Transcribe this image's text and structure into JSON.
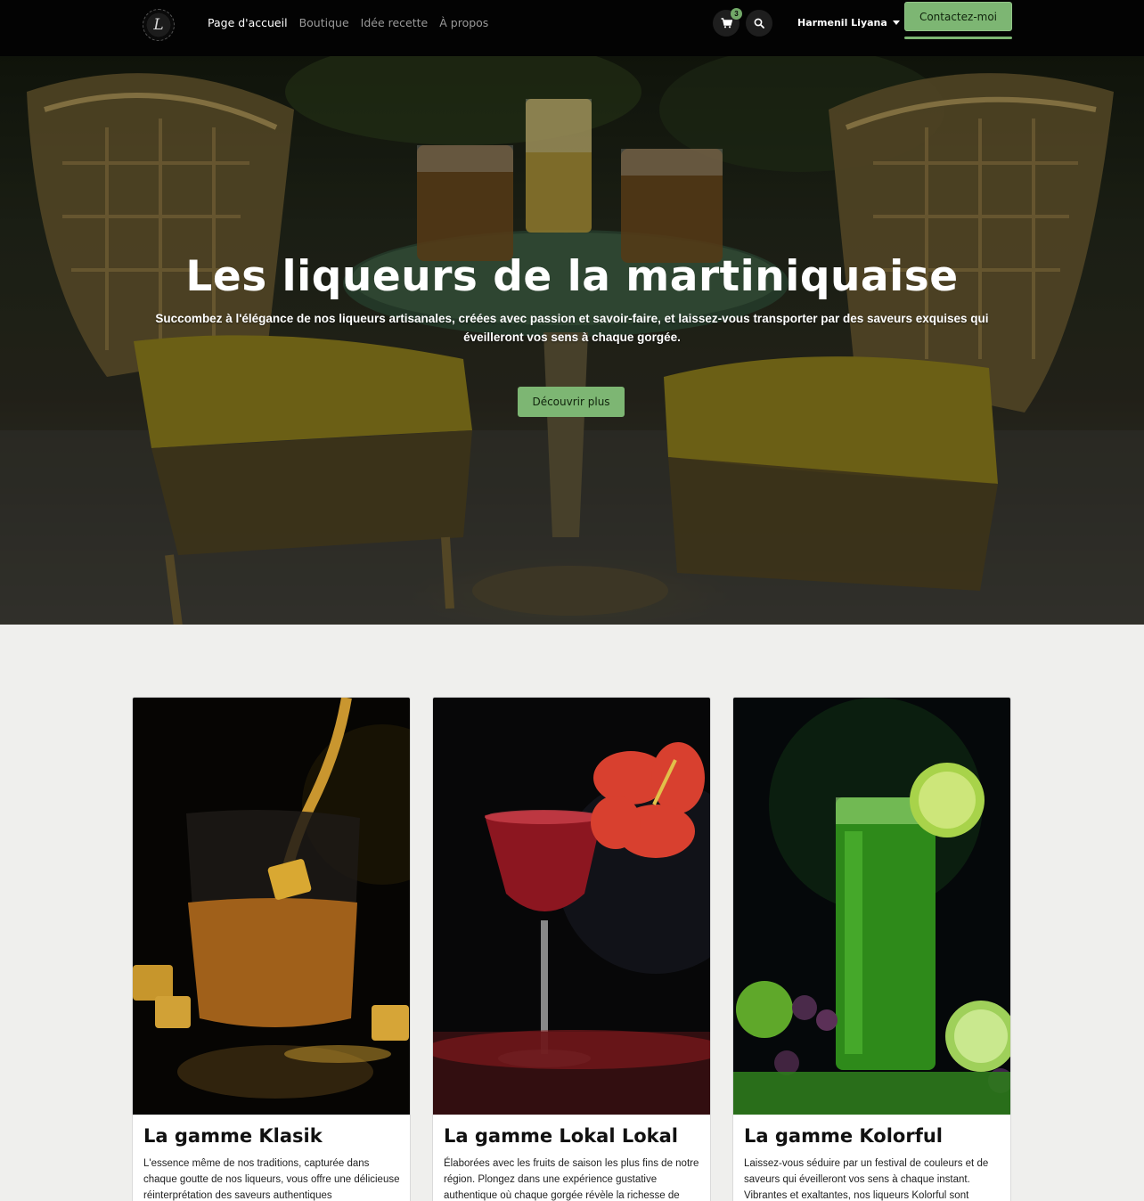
{
  "nav": {
    "links": [
      "Page d'accueil",
      "Boutique",
      "Idée recette",
      "À propos"
    ],
    "cart_count": "3",
    "user_name": "Harmenil Liyana",
    "contact_label": "Contactez-moi",
    "logo_glyph": "L"
  },
  "hero": {
    "title": "Les liqueurs de la martiniquaise",
    "subtitle": "Succombez à l'élégance de nos liqueurs artisanales, créées avec passion et savoir-faire, et laissez-vous transporter par des saveurs exquises qui éveilleront vos sens à chaque gorgée.",
    "cta_label": "Découvrir plus"
  },
  "cards": [
    {
      "title": "La gamme Klasik",
      "text": "L'essence même de nos traditions, capturée dans chaque goutte de nos liqueurs, vous offre une délicieuse réinterprétation des saveurs authentiques"
    },
    {
      "title": "La gamme Lokal Lokal",
      "text": "Élaborées avec les fruits  de saison les plus fins de notre région. Plongez dans une expérience gustative authentique où chaque gorgée révèle la richesse de"
    },
    {
      "title": "La gamme Kolorful",
      "text": "Laissez-vous séduire par un festival de couleurs et de saveurs qui éveilleront vos sens à chaque instant. Vibrantes et exaltantes, nos liqueurs Kolorful sont"
    }
  ],
  "colors": {
    "accent_green": "#7db673",
    "navbar_bg": "#030303",
    "page_bg": "#efefed"
  },
  "icons": [
    "cart-icon",
    "search-icon",
    "caret-down-icon"
  ]
}
